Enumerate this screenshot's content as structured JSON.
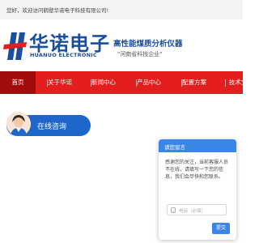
{
  "topbar": {
    "welcome": "您好，欢迎访问鹤壁华诺电子科技有限公司!"
  },
  "header": {
    "brand_name": "华诺电子",
    "brand_en": "HUANUO ELECTRONIC",
    "tagline": "高性能煤质分析仪器",
    "slogan": "\"河南省科技企业\""
  },
  "nav": {
    "items": [
      {
        "label": "首页",
        "active": true
      },
      {
        "label": "关于华诺"
      },
      {
        "label": "新闻中心"
      },
      {
        "label": "产品中心"
      },
      {
        "label": "配置方案"
      },
      {
        "label": "技术文"
      }
    ]
  },
  "consult": {
    "label": "在线咨询"
  },
  "chat": {
    "title": "请您留言",
    "message": "感谢您的关注，当前客服人员不在线，请填写一下您的信息，我们会尽快和您联系。",
    "phone_placeholder": "电话（必填）",
    "send_label": "提交"
  },
  "colors": {
    "brand_blue": "#1b4e9b",
    "nav_red": "#e41e1e",
    "nav_active": "#a30c0c",
    "chat_blue": "#3a86e8"
  },
  "icons": {
    "logo": "huanuo-logo",
    "phone": "phone-icon",
    "avatar": "agent-avatar"
  }
}
